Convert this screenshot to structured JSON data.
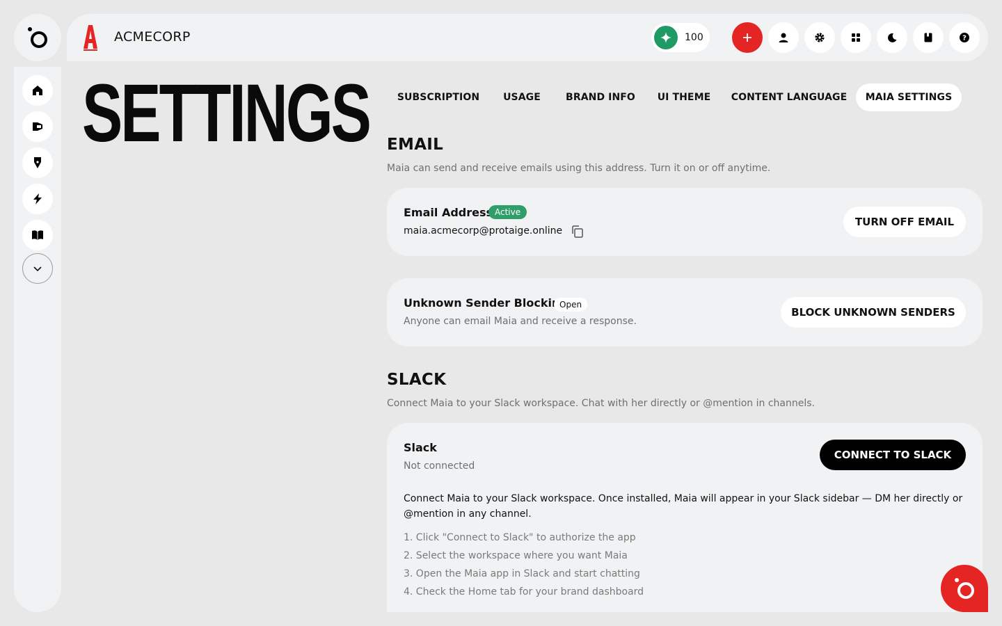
{
  "colors": {
    "accent": "#e52424",
    "success": "#2f9e6a",
    "credits": "#1f9a64"
  },
  "header": {
    "brand_name": "ACMECORP",
    "credits": "100"
  },
  "page": {
    "title": "SETTINGS"
  },
  "tabs": [
    {
      "label": "SUBSCRIPTION"
    },
    {
      "label": "USAGE"
    },
    {
      "label": "BRAND INFO"
    },
    {
      "label": "UI THEME"
    },
    {
      "label": "CONTENT LANGUAGE"
    },
    {
      "label": "MAIA SETTINGS",
      "active": true
    }
  ],
  "email": {
    "title": "EMAIL",
    "description": "Maia can send and receive emails using this address. Turn it on or off anytime.",
    "address_card": {
      "label": "Email Address",
      "status": "Active",
      "address": "maia.acmecorp@protaige.online",
      "button": "TURN OFF EMAIL"
    },
    "blocking_card": {
      "label": "Unknown Sender Blocking",
      "status": "Open",
      "description": "Anyone can email Maia and receive a response.",
      "button": "BLOCK UNKNOWN SENDERS"
    }
  },
  "slack": {
    "title": "SLACK",
    "description": "Connect Maia to your Slack workspace. Chat with her directly or @mention in channels.",
    "card": {
      "label": "Slack",
      "status": "Not connected",
      "button": "CONNECT TO SLACK",
      "intro": "Connect Maia to your Slack workspace. Once installed, Maia will appear in your Slack sidebar — DM her directly or @mention in any channel.",
      "steps": [
        "1. Click \"Connect to Slack\" to authorize the app",
        "2. Select the workspace where you want Maia",
        "3. Open the Maia app in Slack and start chatting",
        "4. Check the Home tab for your brand dashboard"
      ]
    }
  },
  "icons": {
    "app_logo": "ring-dot-icon",
    "sidebar": [
      "home-icon",
      "megaphone-icon",
      "pen-nib-icon",
      "lightning-icon",
      "book-icon",
      "chevron-down-icon"
    ],
    "top": [
      "plus-icon",
      "user-icon",
      "gear-icon",
      "grid-icon",
      "moon-icon",
      "notebook-icon",
      "help-icon"
    ],
    "fab": "ring-dot-icon"
  }
}
